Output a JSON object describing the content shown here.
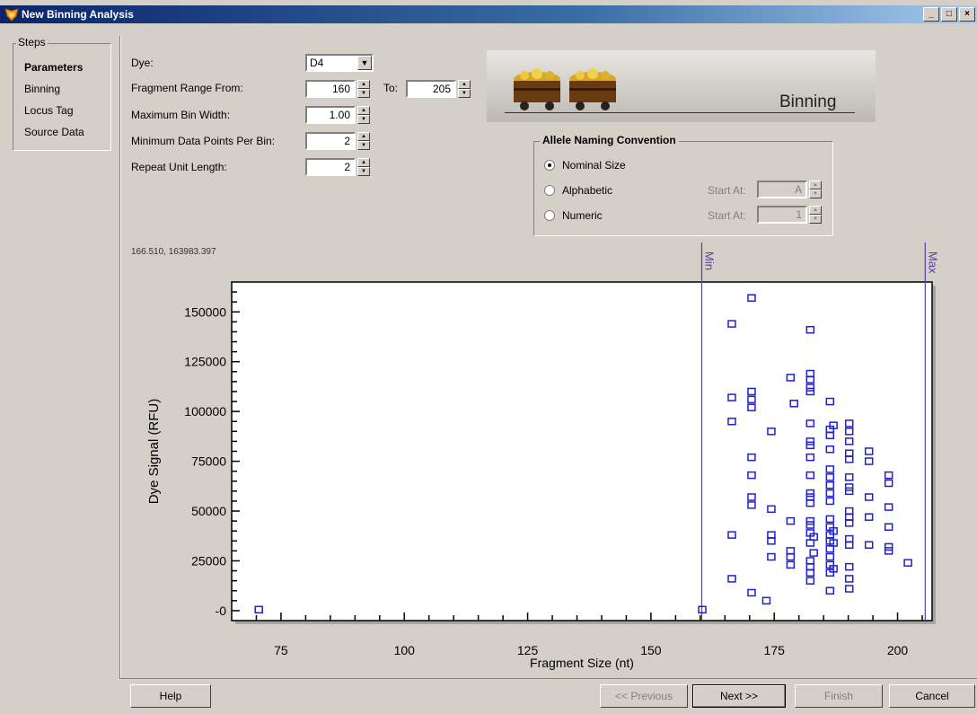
{
  "window": {
    "title": "New Binning Analysis"
  },
  "steps": {
    "legend": "Steps",
    "items": [
      "Parameters",
      "Binning",
      "Locus Tag",
      "Source Data"
    ]
  },
  "params": {
    "dye_label": "Dye:",
    "dye_value": "D4",
    "range_label": "Fragment Range From:",
    "range_from": "160",
    "to_label": "To:",
    "range_to": "205",
    "max_bin_label": "Maximum Bin Width:",
    "max_bin_value": "1.00",
    "min_points_label": "Minimum Data Points Per Bin:",
    "min_points_value": "2",
    "repeat_label": "Repeat Unit Length:",
    "repeat_value": "2"
  },
  "banner": {
    "text": "Binning"
  },
  "naming": {
    "legend": "Allele Naming Convention",
    "options": [
      "Nominal Size",
      "Alphabetic",
      "Numeric"
    ],
    "selected": "Nominal Size",
    "start_at_label": "Start At:",
    "alpha_start": "A",
    "numeric_start": "1"
  },
  "coord_readout": "166.510, 163983.397",
  "chart_data": {
    "type": "scatter",
    "xlabel": "Fragment Size (nt)",
    "ylabel": "Dye Signal (RFU)",
    "xlim": [
      65,
      207
    ],
    "ylim": [
      -5000,
      165000
    ],
    "xticks": [
      75,
      100,
      125,
      150,
      175,
      200
    ],
    "xtick_labels": [
      "75",
      "100",
      "125",
      "150",
      "175",
      "200"
    ],
    "yticks": [
      0,
      25000,
      50000,
      75000,
      100000,
      125000,
      150000
    ],
    "ytick_labels": [
      "-0",
      "25000",
      "50000",
      "75000",
      "100000",
      "125000",
      "150000"
    ],
    "min_marker": {
      "x": 160.3,
      "label": "Min"
    },
    "max_marker": {
      "x": 205.6,
      "label": "Max"
    },
    "marker_color": "#2020cc",
    "points": [
      [
        70.5,
        500
      ],
      [
        160.4,
        500
      ],
      [
        166.4,
        144000
      ],
      [
        166.4,
        107000
      ],
      [
        166.4,
        95000
      ],
      [
        166.4,
        38000
      ],
      [
        166.4,
        16000
      ],
      [
        170.4,
        157000
      ],
      [
        170.4,
        110000
      ],
      [
        170.4,
        106000
      ],
      [
        170.4,
        102000
      ],
      [
        170.4,
        77000
      ],
      [
        170.4,
        68000
      ],
      [
        170.4,
        57000
      ],
      [
        170.4,
        53000
      ],
      [
        170.4,
        9000
      ],
      [
        173.4,
        5000
      ],
      [
        174.4,
        90000
      ],
      [
        174.4,
        51000
      ],
      [
        174.4,
        38000
      ],
      [
        174.4,
        35000
      ],
      [
        174.4,
        27000
      ],
      [
        178.3,
        117000
      ],
      [
        178.3,
        45000
      ],
      [
        178.3,
        30000
      ],
      [
        178.3,
        27000
      ],
      [
        178.3,
        23000
      ],
      [
        179.0,
        104000
      ],
      [
        182.3,
        141000
      ],
      [
        182.3,
        119000
      ],
      [
        182.3,
        116000
      ],
      [
        182.3,
        112000
      ],
      [
        182.3,
        110000
      ],
      [
        182.3,
        94000
      ],
      [
        182.3,
        85000
      ],
      [
        182.3,
        83000
      ],
      [
        182.3,
        77000
      ],
      [
        182.3,
        68000
      ],
      [
        182.3,
        59000
      ],
      [
        182.3,
        57000
      ],
      [
        182.3,
        54000
      ],
      [
        182.3,
        45000
      ],
      [
        182.3,
        43000
      ],
      [
        182.3,
        39000
      ],
      [
        182.3,
        34000
      ],
      [
        182.3,
        25000
      ],
      [
        182.3,
        22000
      ],
      [
        182.3,
        19000
      ],
      [
        182.3,
        15000
      ],
      [
        183.0,
        29000
      ],
      [
        183.0,
        37000
      ],
      [
        186.3,
        105000
      ],
      [
        186.3,
        91000
      ],
      [
        186.3,
        88000
      ],
      [
        186.3,
        81000
      ],
      [
        186.3,
        71000
      ],
      [
        186.3,
        67000
      ],
      [
        186.3,
        63000
      ],
      [
        186.3,
        59000
      ],
      [
        186.3,
        55000
      ],
      [
        186.3,
        46000
      ],
      [
        186.3,
        42000
      ],
      [
        186.3,
        38000
      ],
      [
        186.3,
        35000
      ],
      [
        186.3,
        31000
      ],
      [
        186.3,
        27000
      ],
      [
        186.3,
        23000
      ],
      [
        186.3,
        19000
      ],
      [
        186.3,
        10000
      ],
      [
        187.0,
        93000
      ],
      [
        187.0,
        40000
      ],
      [
        187.0,
        21000
      ],
      [
        187.0,
        34000
      ],
      [
        190.2,
        94000
      ],
      [
        190.2,
        90000
      ],
      [
        190.2,
        85000
      ],
      [
        190.2,
        79000
      ],
      [
        190.2,
        76000
      ],
      [
        190.2,
        67000
      ],
      [
        190.2,
        62000
      ],
      [
        190.2,
        60000
      ],
      [
        190.2,
        50000
      ],
      [
        190.2,
        47000
      ],
      [
        190.2,
        44000
      ],
      [
        190.2,
        36000
      ],
      [
        190.2,
        33000
      ],
      [
        190.2,
        22000
      ],
      [
        190.2,
        16000
      ],
      [
        190.2,
        11000
      ],
      [
        194.2,
        80000
      ],
      [
        194.2,
        75000
      ],
      [
        194.2,
        57000
      ],
      [
        194.2,
        47000
      ],
      [
        194.2,
        33000
      ],
      [
        198.2,
        68000
      ],
      [
        198.2,
        64000
      ],
      [
        198.2,
        52000
      ],
      [
        198.2,
        42000
      ],
      [
        198.2,
        32000
      ],
      [
        198.2,
        30000
      ],
      [
        202.1,
        24000
      ]
    ]
  },
  "buttons": {
    "help": "Help",
    "previous": "<< Previous",
    "next": "Next >>",
    "finish": "Finish",
    "cancel": "Cancel"
  }
}
